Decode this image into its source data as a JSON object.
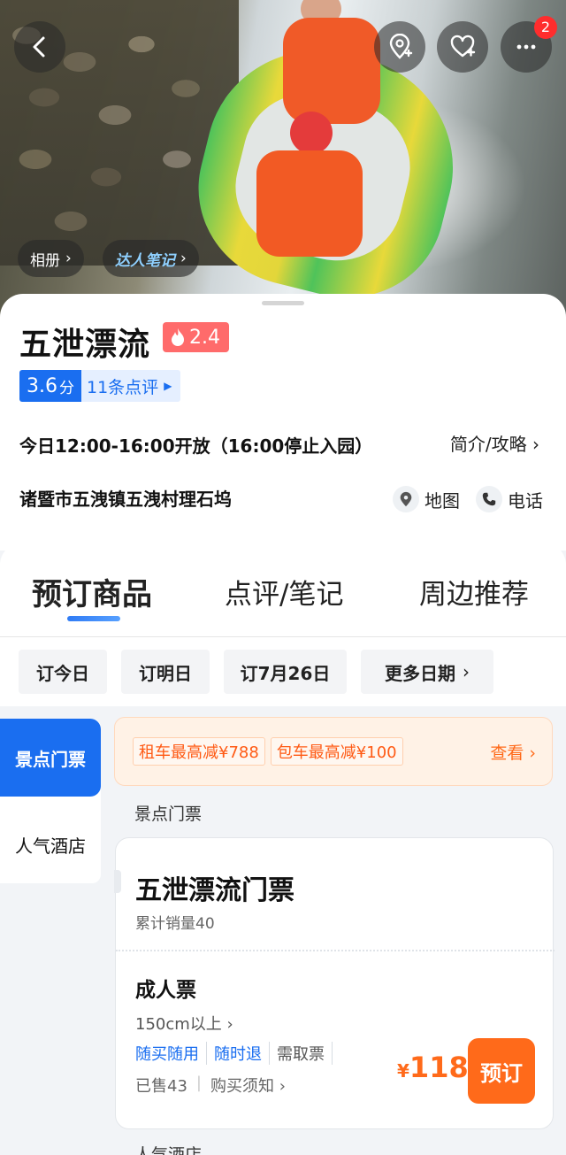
{
  "hero": {
    "album_label": "相册",
    "notes_label": "达人笔记",
    "more_badge_count": "2"
  },
  "info": {
    "title": "五泄漂流",
    "heat_value": "2.4",
    "score": "3.6",
    "score_unit": "分",
    "review_count_label": "11条点评",
    "hours": "今日12:00-16:00开放（16:00停止入园）",
    "intro_link": "简介/攻略",
    "address": "诸暨市五洩镇五洩村理石坞",
    "map_label": "地图",
    "phone_label": "电话"
  },
  "tabs": [
    "预订商品",
    "点评/笔记",
    "周边推荐"
  ],
  "dates": [
    "订今日",
    "订明日",
    "订7月26日",
    "更多日期"
  ],
  "side_nav": [
    "景点门票",
    "人气酒店"
  ],
  "promo": {
    "tags": [
      "租车最高减¥788",
      "包车最高减¥100"
    ],
    "see_label": "查看"
  },
  "section_label": "景点门票",
  "product": {
    "name": "五泄漂流门票",
    "sales": "累计销量40",
    "ticket_type": "成人票",
    "height_req": "150cm以上",
    "policies": [
      "随买随用",
      "随时退",
      "需取票"
    ],
    "sold": "已售43",
    "purchase_notes": "购买须知",
    "currency": "¥",
    "price": "118",
    "book_label": "预订"
  },
  "next_section_label": "人气酒店",
  "colors": {
    "primary_blue": "#1a6ef0",
    "accent_orange": "#ff6a1a",
    "heat_red": "#ff6b6b"
  }
}
